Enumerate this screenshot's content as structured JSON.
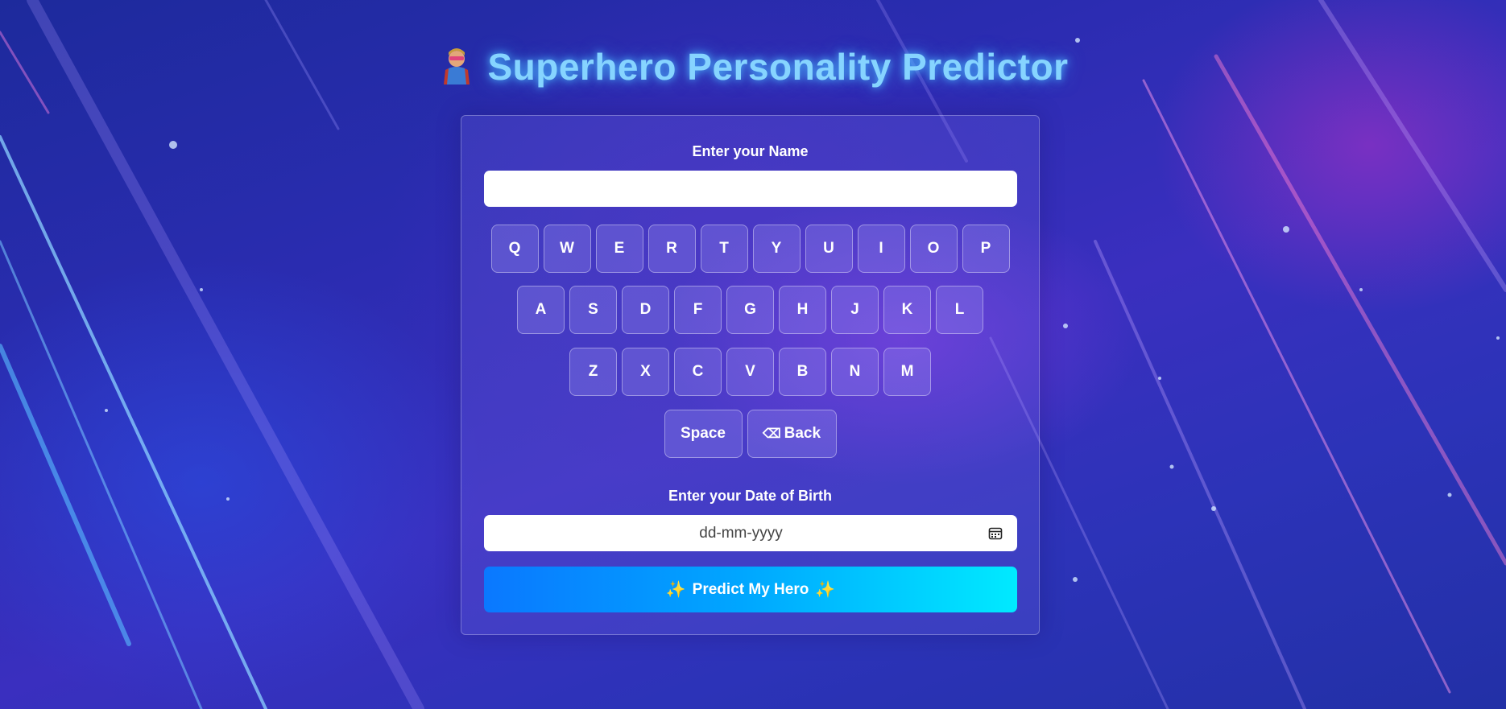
{
  "title": {
    "text": "Superhero Personality Predictor",
    "icon": "superhero-icon"
  },
  "form": {
    "name_label": "Enter your Name",
    "name_value": "",
    "dob_label": "Enter your Date of Birth",
    "dob_placeholder": "dd-mm-yyyy",
    "calendar_icon": "calendar-icon",
    "predict_label": "Predict My Hero",
    "sparkle_icon": "sparkle-icon"
  },
  "keyboard": {
    "row1": [
      "Q",
      "W",
      "E",
      "R",
      "T",
      "Y",
      "U",
      "I",
      "O",
      "P"
    ],
    "row2": [
      "A",
      "S",
      "D",
      "F",
      "G",
      "H",
      "J",
      "K",
      "L"
    ],
    "row3": [
      "Z",
      "X",
      "C",
      "V",
      "B",
      "N",
      "M"
    ],
    "space_label": "Space",
    "back_label": "Back",
    "back_icon": "backspace-icon"
  },
  "colors": {
    "title": "#86d4ff",
    "button_start": "#0a78ff",
    "button_end": "#00eaff"
  }
}
